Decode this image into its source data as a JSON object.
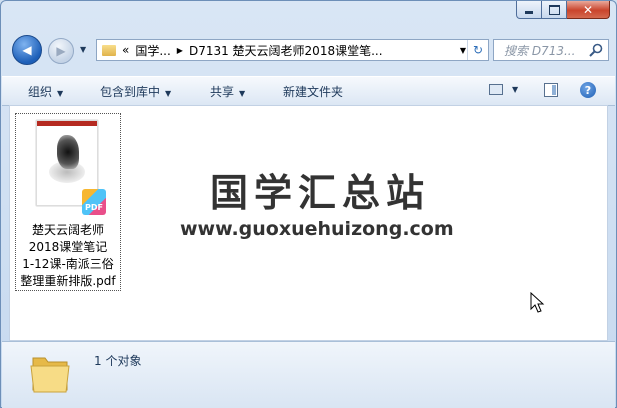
{
  "window": {
    "close_label": "✕"
  },
  "nav": {
    "back_label": "◀",
    "forward_label": "▶",
    "history_label": "▼"
  },
  "address": {
    "overflow": "«",
    "crumbs": [
      "国学...",
      "D7131 楚天云阔老师2018课堂笔..."
    ],
    "dropdown": "▼",
    "refresh": "↻"
  },
  "search": {
    "placeholder": "搜索 D713..."
  },
  "toolbar": {
    "organize": "组织",
    "include_library": "包含到库中",
    "share": "共享",
    "new_folder": "新建文件夹",
    "help": "?"
  },
  "file": {
    "badge": "PDF",
    "thumb_label": "PDF",
    "name_lines": [
      "楚天云阔老师",
      "2018课堂笔记",
      "1-12课-南派三俗",
      "整理重新排版.pdf"
    ]
  },
  "watermark": {
    "title": "国学汇总站",
    "url": "www.guoxuehuizong.com"
  },
  "status": {
    "count": "1 个对象"
  },
  "colors": {
    "accent": "#1e395b",
    "close_red": "#c9442c"
  }
}
